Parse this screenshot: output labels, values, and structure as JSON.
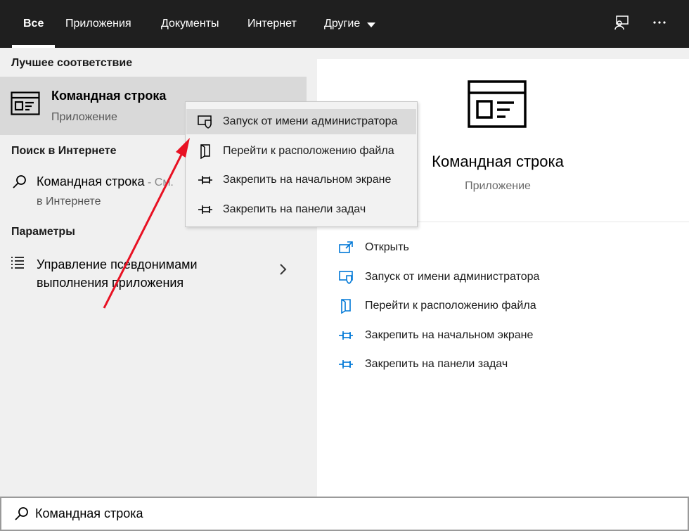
{
  "tabs": [
    {
      "label": "Все",
      "active": true
    },
    {
      "label": "Приложения"
    },
    {
      "label": "Документы"
    },
    {
      "label": "Интернет"
    },
    {
      "label": "Другие"
    }
  ],
  "left": {
    "best_match_header": "Лучшее соответствие",
    "best_match": {
      "title": "Командная строка",
      "subtitle": "Приложение"
    },
    "web_header": "Поиск в Интернете",
    "web_item": {
      "main": "Командная строка",
      "suffix": " - См.",
      "subtitle": "в Интернете"
    },
    "settings_header": "Параметры",
    "settings_item": {
      "line1": "Управление псевдонимами",
      "line2": "выполнения приложения"
    }
  },
  "context_menu": [
    {
      "label": "Запуск от имени администратора",
      "icon": "shield-icon"
    },
    {
      "label": "Перейти к расположению файла",
      "icon": "folder-icon"
    },
    {
      "label": "Закрепить на начальном экране",
      "icon": "pin-icon"
    },
    {
      "label": "Закрепить на панели задач",
      "icon": "pin-icon"
    }
  ],
  "right": {
    "title": "Командная строка",
    "subtitle": "Приложение",
    "actions": [
      {
        "label": "Открыть",
        "icon": "open-icon"
      },
      {
        "label": "Запуск от имени администратора",
        "icon": "shield-icon"
      },
      {
        "label": "Перейти к расположению файла",
        "icon": "folder-icon"
      },
      {
        "label": "Закрепить на начальном экране",
        "icon": "pin-icon"
      },
      {
        "label": "Закрепить на панели задач",
        "icon": "pin-icon"
      }
    ]
  },
  "search": {
    "value": "Командная строка"
  },
  "colors": {
    "accent": "#0078d7",
    "topbar": "#1f1f1f",
    "arrow": "#e81123"
  }
}
